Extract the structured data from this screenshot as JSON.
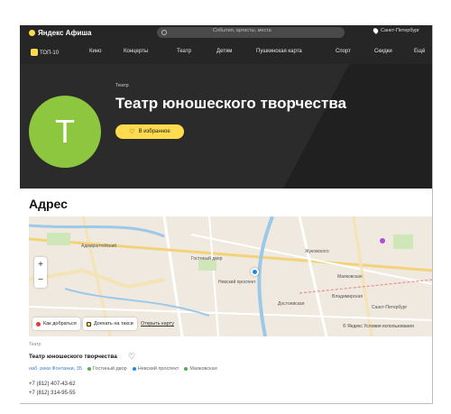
{
  "header": {
    "logo_text": "Яндекс Афиша",
    "search_placeholder": "События, артисты, места",
    "city": "Санкт-Петербург"
  },
  "nav": {
    "items": [
      "ТОП-10",
      "Кино",
      "Концерты",
      "Театр",
      "Детям",
      "Пушкинская карта",
      "Спорт",
      "Скидки",
      "Ещё"
    ]
  },
  "hero": {
    "category": "Театр",
    "title": "Театр юношеского творчества",
    "avatar_letter": "Т",
    "favorite_label": "В избранное"
  },
  "address_section": {
    "title": "Адрес"
  },
  "map": {
    "zoom_in": "+",
    "zoom_out": "−",
    "route_label": "Как добраться",
    "taxi_label": "Доехать на такси",
    "open_map_link": "Открыть карту",
    "copyright": "© Яндекс Условия использования",
    "labels": [
      "Адмиралтейский",
      "Гостиный двор",
      "Невский проспект",
      "Жуковского",
      "Маяковская",
      "Достоевская",
      "Владимирская",
      "Санкт-Петербург"
    ]
  },
  "venue_info": {
    "category": "Театр",
    "name": "Театр юношеского творчества",
    "address": "наб. реки Фонтанки, 35",
    "metro": [
      {
        "name": "Гостиный двор",
        "color": "#4caf50"
      },
      {
        "name": "Невский проспект",
        "color": "#1e88e5"
      },
      {
        "name": "Маяковская",
        "color": "#4caf50"
      }
    ],
    "phones": [
      "+7 (812) 407-43-62",
      "+7 (812) 314-95-55"
    ]
  },
  "colors": {
    "accent": "#ffdb4d",
    "avatar": "#8dc63f",
    "header_bg": "#262626"
  }
}
